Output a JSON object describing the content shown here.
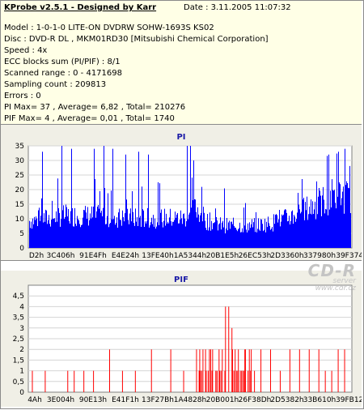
{
  "header": {
    "program": "KProbe v2.5.1 - Designed by Karr",
    "date": "Date : 3.11.2005 11:07:32"
  },
  "info_lines": [
    "Model : 1-0-1-0 LITE-ON DVDRW SOHW-1693S KS02",
    "Disc : DVD-R DL , MKM01RD30 [Mitsubishi Chemical Corporation]",
    "Speed : 4x",
    "ECC blocks sum (PI/PIF) : 8/1",
    "Scanned range : 0 - 4171698",
    "Sampling count : 209813",
    "Errors : 0",
    "PI Max= 37 , Average= 6,82 , Total= 210276",
    "PIF Max= 4 , Average= 0,01 , Total= 1740"
  ],
  "watermark": {
    "line1": "CD-R",
    "line2": "server",
    "line3": "www.cdr.cz"
  },
  "colors": {
    "pi_series": "#0000ff",
    "pif_series": "#ff0000",
    "info_bg": "#ffffe6",
    "panel_bg": "#f0efe6"
  },
  "chart_data": [
    {
      "type": "bar",
      "title": "PI",
      "ylim": [
        0,
        35
      ],
      "yticks": [
        "0",
        "5",
        "10",
        "15",
        "20",
        "25",
        "30",
        "35"
      ],
      "xticks": [
        "D2h",
        "3C406h",
        "91E4Fh",
        "E4E24h",
        "13FE40h",
        "1A5344h",
        "20B1E5h",
        "26EC53h",
        "2D3360h",
        "337980h",
        "39F374h"
      ],
      "grid": true,
      "envelope_x": [
        0,
        0.06,
        0.1,
        0.2,
        0.3,
        0.4,
        0.45,
        0.48,
        0.5,
        0.52,
        0.55,
        0.6,
        0.7,
        0.75,
        0.8,
        0.85,
        0.9,
        0.95,
        1.0
      ],
      "envelope_y": [
        11,
        12,
        13,
        13,
        12,
        12,
        12,
        12,
        14,
        16,
        11,
        9,
        9,
        10,
        12,
        15,
        18,
        22,
        20
      ],
      "spikes_x": [
        0.04,
        0.1,
        0.13,
        0.2,
        0.23,
        0.26,
        0.3,
        0.34,
        0.37,
        0.49,
        0.5,
        0.51,
        0.93,
        0.96,
        0.98
      ],
      "spikes_y": [
        33,
        35,
        34,
        34,
        35,
        34,
        32,
        33,
        32,
        37,
        36,
        30,
        32,
        33,
        34
      ]
    },
    {
      "type": "bar",
      "title": "PIF",
      "ylim": [
        0,
        5
      ],
      "yticks": [
        "0",
        "0,5",
        "1",
        "1,5",
        "2",
        "2,5",
        "3",
        "3,5",
        "4",
        "4,5"
      ],
      "xticks": [
        "4Ah",
        "3E004h",
        "90E13h",
        "E41F1h",
        "13F27Bh",
        "1A4828h",
        "20B001h",
        "26F38Dh",
        "2D5382h",
        "33B610h",
        "39FB12h"
      ],
      "grid": true,
      "bars_x": [
        0.01,
        0.05,
        0.12,
        0.14,
        0.17,
        0.2,
        0.25,
        0.29,
        0.33,
        0.38,
        0.44,
        0.48,
        0.52,
        0.53,
        0.54,
        0.55,
        0.56,
        0.57,
        0.58,
        0.59,
        0.6,
        0.61,
        0.62,
        0.63,
        0.64,
        0.65,
        0.66,
        0.67,
        0.68,
        0.69,
        0.7,
        0.72,
        0.75,
        0.78,
        0.81,
        0.84,
        0.87,
        0.9,
        0.92,
        0.94,
        0.96,
        0.98
      ],
      "bars_y": [
        1,
        1,
        1,
        1,
        1,
        1,
        2,
        1,
        1,
        2,
        2,
        1,
        2,
        2,
        2,
        1,
        2,
        2,
        1,
        2,
        2,
        4,
        4,
        3,
        2,
        2,
        1,
        2,
        1,
        2,
        1,
        2,
        2,
        1,
        2,
        2,
        2,
        2,
        1,
        1,
        2,
        2
      ]
    }
  ]
}
